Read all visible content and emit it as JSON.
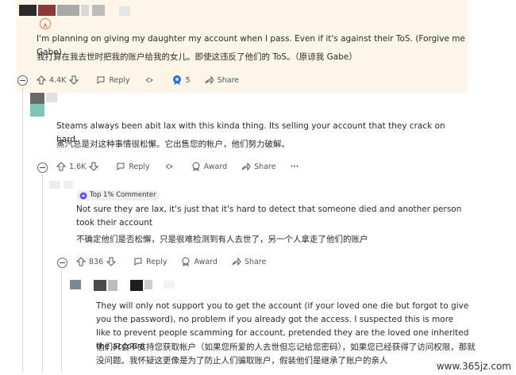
{
  "comments": [
    {
      "text_en": "I'm planning on giving my daughter my account when I pass. Even if it's against their ToS. (Forgive me Gabe)",
      "text_zh": "我打算在我去世时把我的账户给我的女儿。即使这违反了他们的 ToS。（原谅我 Gabe）",
      "votes": "4.4K",
      "reply_label": "Reply",
      "award_count": "5",
      "share_label": "Share"
    },
    {
      "text_en": "Steams always been abit lax with this kinda thing. Its selling your account that they crack on hard.",
      "text_zh": "蒸汽总是对这种事情很松懈。它出售您的帐户，他们努力破解。",
      "votes": "1.6K",
      "reply_label": "Reply",
      "award_label": "Award",
      "share_label": "Share",
      "more_label": "···"
    },
    {
      "badge": "Top 1% Commenter",
      "text_en": "Not sure they are lax, it's just that it's hard to detect that someone died and another person took their account",
      "text_zh": "不确定他们是否松懈，只是很难检测到有人去世了，另一个人拿走了他们的账户",
      "votes": "836",
      "reply_label": "Reply",
      "award_label": "Award",
      "share_label": "Share"
    },
    {
      "text_en": "They will only not support you to get the account (if your loved one die but forgot to give you the password), no problem if you already got the access. I suspected this is more like to prevent people scamming for account, pretended they are the loved one inherited the account",
      "text_zh": "他们只会不支持您获取帐户（如果您所爱的人去世但忘记给您密码），如果您已经获得了访问权限，那就没问题。我怀疑这更像是为了防止人们骗取账户，假装他们是继承了账户的亲人"
    }
  ],
  "watermark": "www.365jz.com",
  "colors": {
    "highlight_bg": "#fbf6e8",
    "award_blue": "#2d6fd6"
  }
}
